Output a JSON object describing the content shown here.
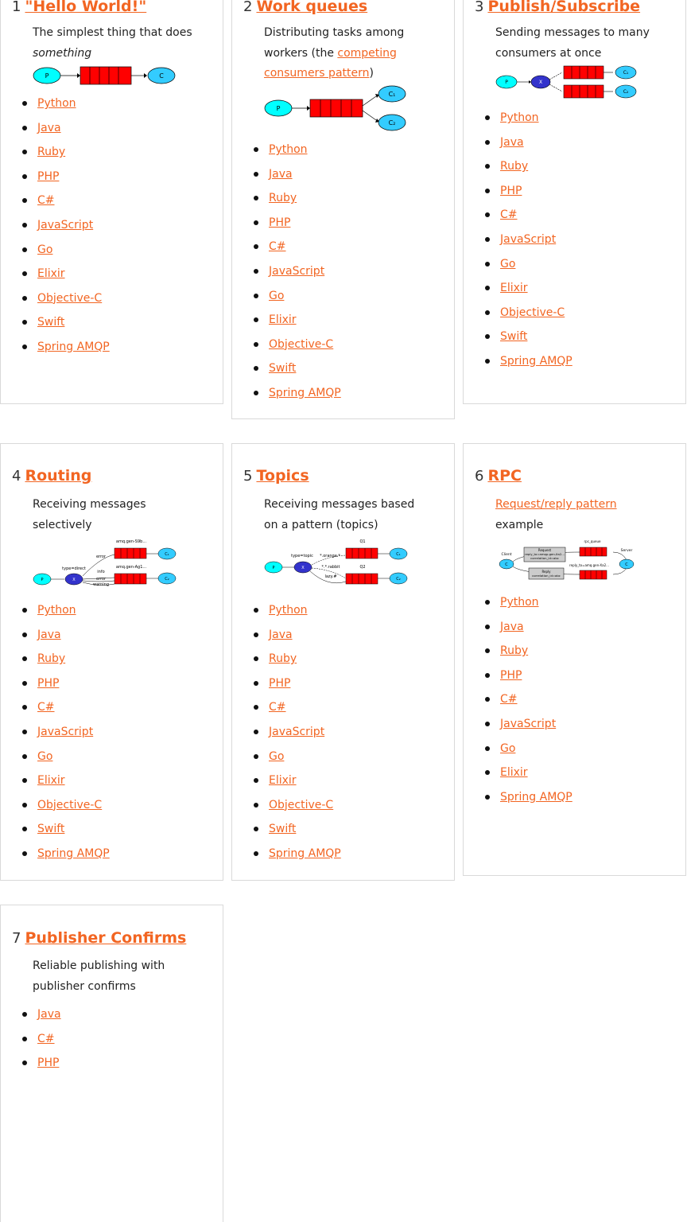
{
  "tutorials": [
    {
      "number": "1",
      "title": "\"Hello World!\"",
      "desc_text": "The simplest thing that does",
      "desc_em": "something",
      "languages": [
        "Python",
        "Java",
        "Ruby",
        "PHP",
        "C#",
        "JavaScript",
        "Go",
        "Elixir",
        "Objective-C",
        "Swift",
        "Spring AMQP"
      ]
    },
    {
      "number": "2",
      "title": "Work queues",
      "desc_pre": "Distributing tasks among workers (the",
      "desc_link": "competing consumers pattern",
      "desc_post": ")",
      "languages": [
        "Python",
        "Java",
        "Ruby",
        "PHP",
        "C#",
        "JavaScript",
        "Go",
        "Elixir",
        "Objective-C",
        "Swift",
        "Spring AMQP"
      ]
    },
    {
      "number": "3",
      "title": "Publish/Subscribe",
      "desc_text": "Sending messages to many consumers at once",
      "languages": [
        "Python",
        "Java",
        "Ruby",
        "PHP",
        "C#",
        "JavaScript",
        "Go",
        "Elixir",
        "Objective-C",
        "Swift",
        "Spring AMQP"
      ]
    },
    {
      "number": "4",
      "title": "Routing",
      "desc_text": "Receiving messages selectively",
      "languages": [
        "Python",
        "Java",
        "Ruby",
        "PHP",
        "C#",
        "JavaScript",
        "Go",
        "Elixir",
        "Objective-C",
        "Swift",
        "Spring AMQP"
      ]
    },
    {
      "number": "5",
      "title": "Topics",
      "desc_text": "Receiving messages based on a pattern (topics)",
      "languages": [
        "Python",
        "Java",
        "Ruby",
        "PHP",
        "C#",
        "JavaScript",
        "Go",
        "Elixir",
        "Objective-C",
        "Swift",
        "Spring AMQP"
      ]
    },
    {
      "number": "6",
      "title": "RPC",
      "desc_link": "Request/reply pattern",
      "desc_post": "example",
      "languages": [
        "Python",
        "Java",
        "Ruby",
        "PHP",
        "C#",
        "JavaScript",
        "Go",
        "Elixir",
        "Spring AMQP"
      ]
    },
    {
      "number": "7",
      "title": "Publisher Confirms",
      "desc_text": "Reliable publishing with publisher confirms",
      "languages": [
        "Java",
        "C#",
        "PHP"
      ]
    }
  ],
  "diagram_labels": {
    "producer": "P",
    "consumer": "C",
    "exchange": "X",
    "c1": "C₁",
    "c2": "C₂",
    "routing_type": "type=direct",
    "routing_q1": "amq.gen-S9b...",
    "routing_q2": "amq.gen-Ag1...",
    "routing_error": "error",
    "routing_info": "info",
    "routing_warning": "warning",
    "topic_type": "type=topic",
    "topic_q1": "Q1",
    "topic_q2": "Q2",
    "topic_orange": "*.orange.*",
    "topic_rabbit": "*.*.rabbit",
    "topic_lazy": "lazy.#",
    "rpc_client": "Client",
    "rpc_server": "Server",
    "rpc_queue": "rpc_queue",
    "rpc_reply_queue": "reply_to=amq.gen-Xa2...",
    "rpc_request_title": "Request",
    "rpc_request_line1": "reply_to=amqp.gen-Xa2...",
    "rpc_request_line2": "correlation_id=abc",
    "rpc_reply_title": "Reply",
    "rpc_reply_line1": "correlation_id=abc"
  },
  "colors": {
    "accent": "#f26522",
    "queue_red": "#ff0000",
    "producer_cyan": "#00ffff",
    "consumer_blue": "#33ccff",
    "exchange_blue": "#3333cc"
  }
}
